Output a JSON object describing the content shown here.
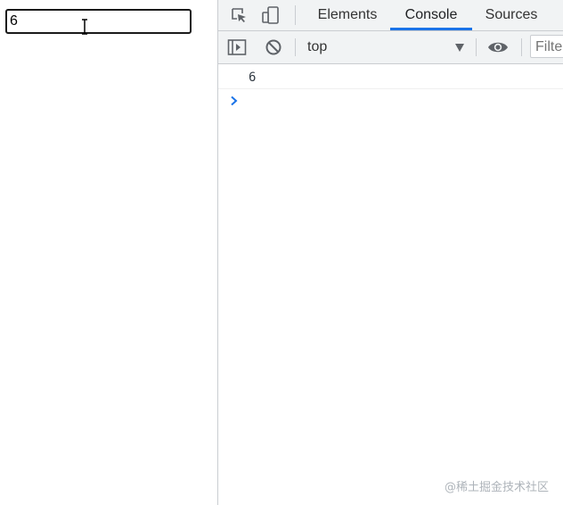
{
  "page": {
    "input_value": "6"
  },
  "devtools": {
    "tabs": [
      {
        "label": "Elements",
        "active": false
      },
      {
        "label": "Console",
        "active": true
      },
      {
        "label": "Sources",
        "active": false
      }
    ],
    "toolbar": {
      "context": "top",
      "filter_placeholder": "Filter"
    },
    "console": {
      "logs": [
        "6"
      ]
    },
    "accent_color": "#1a73e8",
    "icons": {
      "inspect": "inspect-element-icon",
      "device": "device-toolbar-icon",
      "sidebar": "console-sidebar-icon",
      "clear": "clear-console-icon",
      "eye": "live-expression-icon",
      "prompt": "console-prompt-icon"
    }
  },
  "watermark": "@稀土掘金技术社区"
}
